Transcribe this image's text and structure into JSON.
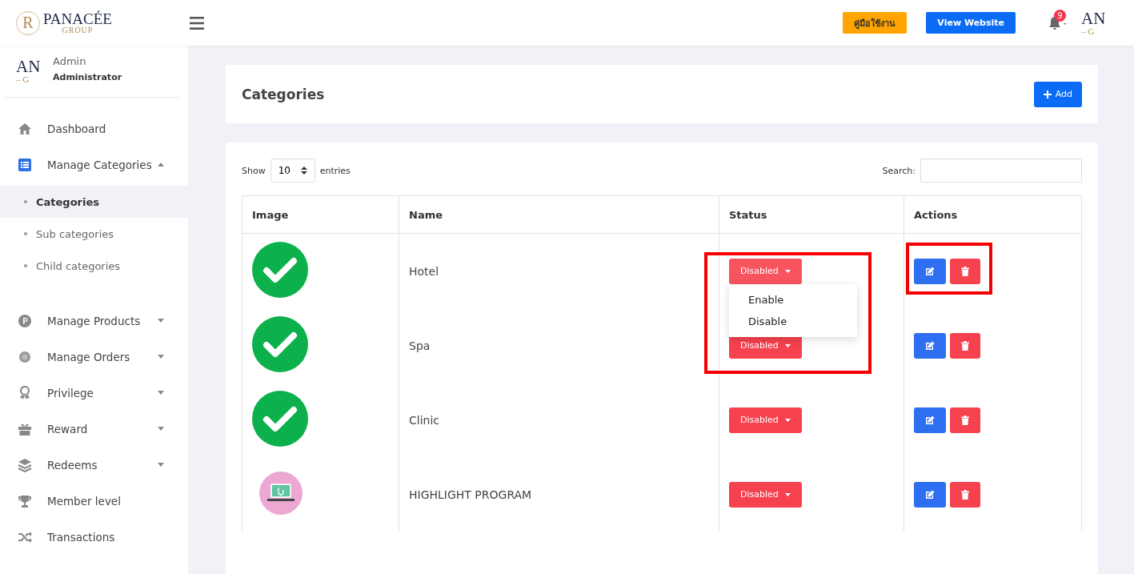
{
  "header": {
    "logo": {
      "name": "PANACÉE",
      "sub": "GROUP",
      "seal": "R"
    },
    "manual_button": "คู่มือใช้งาน",
    "website_button": "View Website",
    "notification_count": "9",
    "avatar_lines": [
      "AN",
      "– G"
    ]
  },
  "sidebar": {
    "user": {
      "avatar_lines": [
        "AN",
        "– G"
      ],
      "name": "Admin",
      "role": "Administrator"
    },
    "items": [
      {
        "kind": "home",
        "label": "Dashboard"
      },
      {
        "kind": "list",
        "label": "Manage Categories",
        "expanded": true,
        "children": [
          {
            "label": "Categories",
            "selected": true
          },
          {
            "label": "Sub categories",
            "selected": false
          },
          {
            "label": "Child categories",
            "selected": false
          }
        ]
      },
      {
        "kind": "product",
        "label": "Manage Products",
        "expanded": false
      },
      {
        "kind": "order",
        "label": "Manage Orders",
        "expanded": false
      },
      {
        "kind": "award",
        "label": "Privilege",
        "expanded": false
      },
      {
        "kind": "gift",
        "label": "Reward",
        "expanded": false
      },
      {
        "kind": "layers",
        "label": "Redeems",
        "expanded": false
      },
      {
        "kind": "trophy",
        "label": "Member level"
      },
      {
        "kind": "shuffle",
        "label": "Transactions"
      }
    ]
  },
  "page": {
    "title": "Categories",
    "add_button": "Add"
  },
  "table_controls": {
    "show_label": "Show",
    "page_size": "10",
    "entries_label": "entries",
    "search_label": "Search:"
  },
  "table": {
    "columns": [
      "Image",
      "Name",
      "Status",
      "Actions"
    ],
    "rows": [
      {
        "kind": "check",
        "name": "Hotel",
        "status": "Disabled",
        "menu_open": true,
        "status_highlighted": true,
        "actions_highlighted": true
      },
      {
        "kind": "check",
        "name": "Spa",
        "status": "Disabled"
      },
      {
        "kind": "check",
        "name": "Clinic",
        "status": "Disabled"
      },
      {
        "kind": "laptop",
        "name": "HIGHLIGHT PROGRAM",
        "status": "Disabled"
      }
    ],
    "status_menu": [
      "Enable",
      "Disable"
    ]
  }
}
